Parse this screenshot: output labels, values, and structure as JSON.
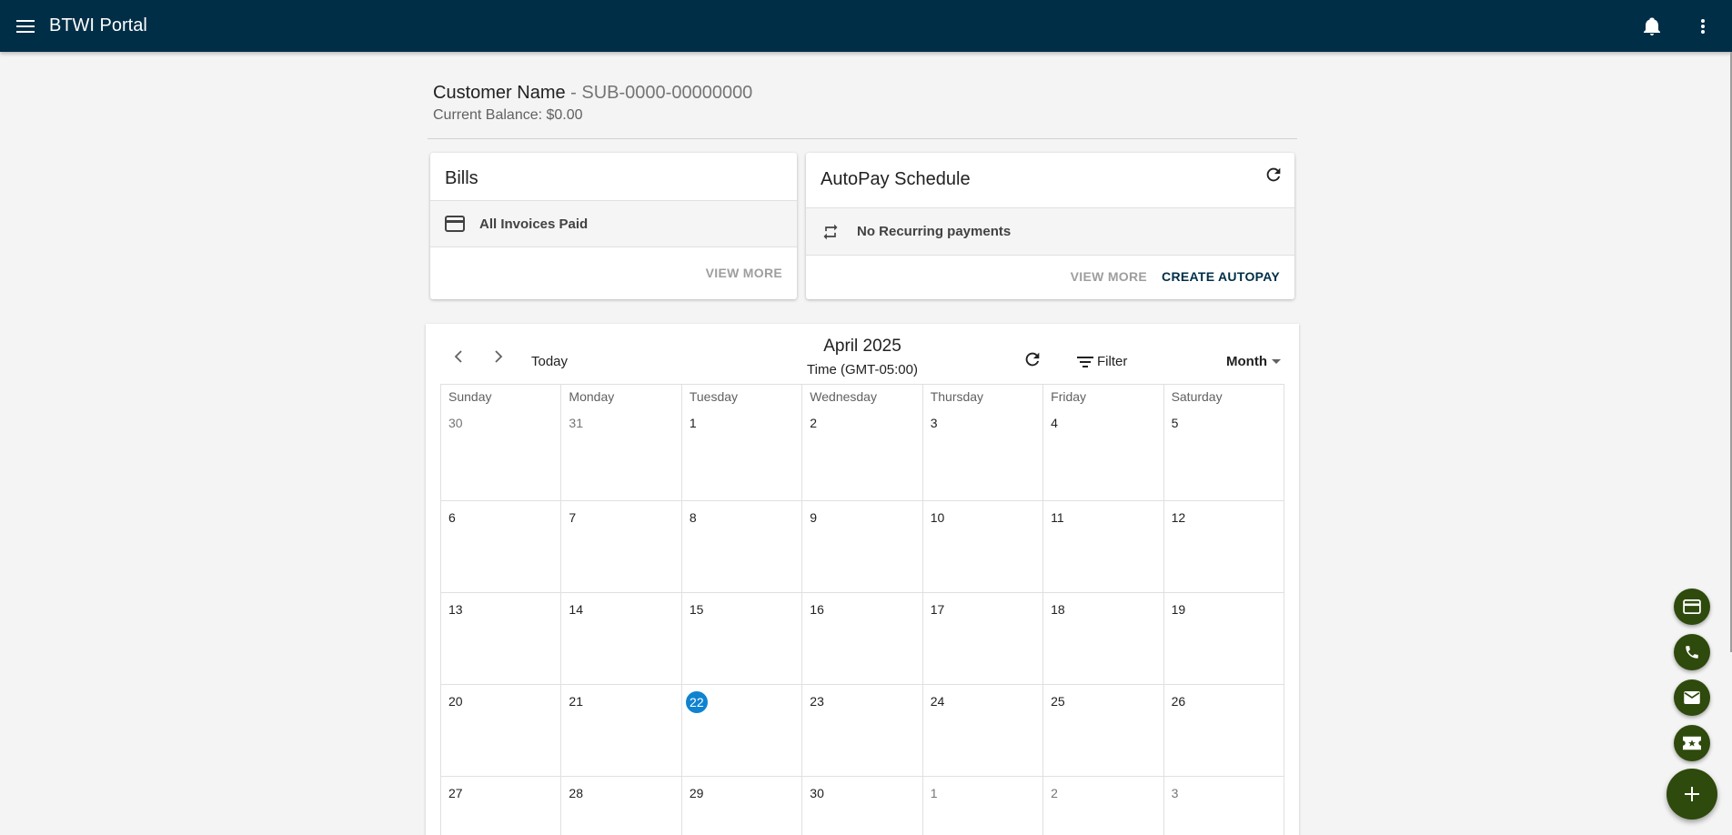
{
  "app": {
    "title": "BTWI Portal"
  },
  "header_icons": {
    "menu": "menu-icon",
    "notifications": "bell-icon",
    "more": "more-vert-icon"
  },
  "customer": {
    "name": "Customer Name",
    "subscriber_id": "- SUB-0000-00000000",
    "balance": "Current Balance: $0.00"
  },
  "bills": {
    "title": "Bills",
    "status": "All Invoices Paid",
    "view_more": "VIEW MORE"
  },
  "autopay": {
    "title": "AutoPay Schedule",
    "status": "No Recurring payments",
    "view_more": "VIEW MORE",
    "create": "CREATE AUTOPAY"
  },
  "calendar": {
    "today_label": "Today",
    "month_title": "April 2025",
    "timezone": "Time (GMT-05:00)",
    "filter_label": "Filter",
    "view_label": "Month",
    "weekdays": [
      "Sunday",
      "Monday",
      "Tuesday",
      "Wednesday",
      "Thursday",
      "Friday",
      "Saturday"
    ],
    "weeks": [
      [
        {
          "d": "30",
          "muted": true
        },
        {
          "d": "31",
          "muted": true
        },
        {
          "d": "1"
        },
        {
          "d": "2"
        },
        {
          "d": "3"
        },
        {
          "d": "4"
        },
        {
          "d": "5"
        }
      ],
      [
        {
          "d": "6"
        },
        {
          "d": "7"
        },
        {
          "d": "8"
        },
        {
          "d": "9"
        },
        {
          "d": "10"
        },
        {
          "d": "11"
        },
        {
          "d": "12"
        }
      ],
      [
        {
          "d": "13"
        },
        {
          "d": "14"
        },
        {
          "d": "15"
        },
        {
          "d": "16"
        },
        {
          "d": "17"
        },
        {
          "d": "18"
        },
        {
          "d": "19"
        }
      ],
      [
        {
          "d": "20"
        },
        {
          "d": "21"
        },
        {
          "d": "22",
          "today": true
        },
        {
          "d": "23"
        },
        {
          "d": "24"
        },
        {
          "d": "25"
        },
        {
          "d": "26"
        }
      ],
      [
        {
          "d": "27"
        },
        {
          "d": "28"
        },
        {
          "d": "29"
        },
        {
          "d": "30"
        },
        {
          "d": "1",
          "muted": true
        },
        {
          "d": "2",
          "muted": true
        },
        {
          "d": "3",
          "muted": true
        }
      ]
    ]
  },
  "speed_dial": [
    "credit-card-icon",
    "phone-icon",
    "email-icon",
    "ticket-icon"
  ],
  "colors": {
    "appbar": "#002e47",
    "fab": "#2e4a0c",
    "today": "#1083d0"
  }
}
